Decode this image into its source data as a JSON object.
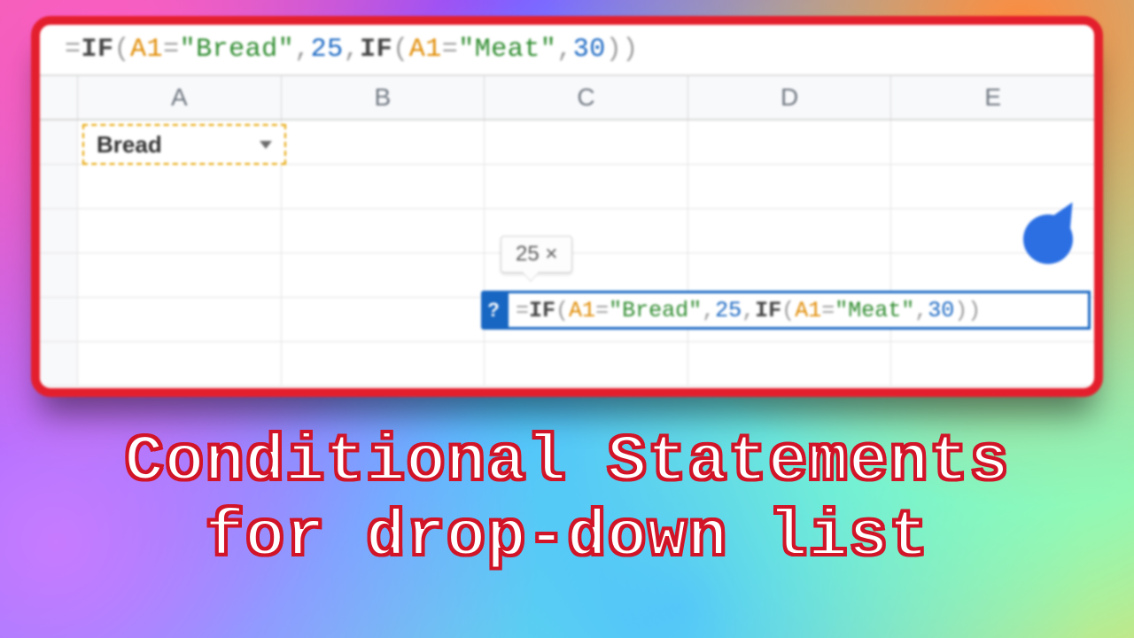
{
  "formula": {
    "eq": "=",
    "if": "IF",
    "lp": "(",
    "rp": ")",
    "ref": "A1",
    "eqop": "=",
    "str_bread": "\"Bread\"",
    "str_meat": "\"Meat\"",
    "comma": ",",
    "num25": "25",
    "num30": "30"
  },
  "columns": [
    "A",
    "B",
    "C",
    "D",
    "E"
  ],
  "dropdown": {
    "value": "Bread"
  },
  "tooltip": {
    "text": "25 ×"
  },
  "hint_badge": "?",
  "caption": {
    "line1": "Conditional Statements",
    "line2": "for drop-down list"
  }
}
